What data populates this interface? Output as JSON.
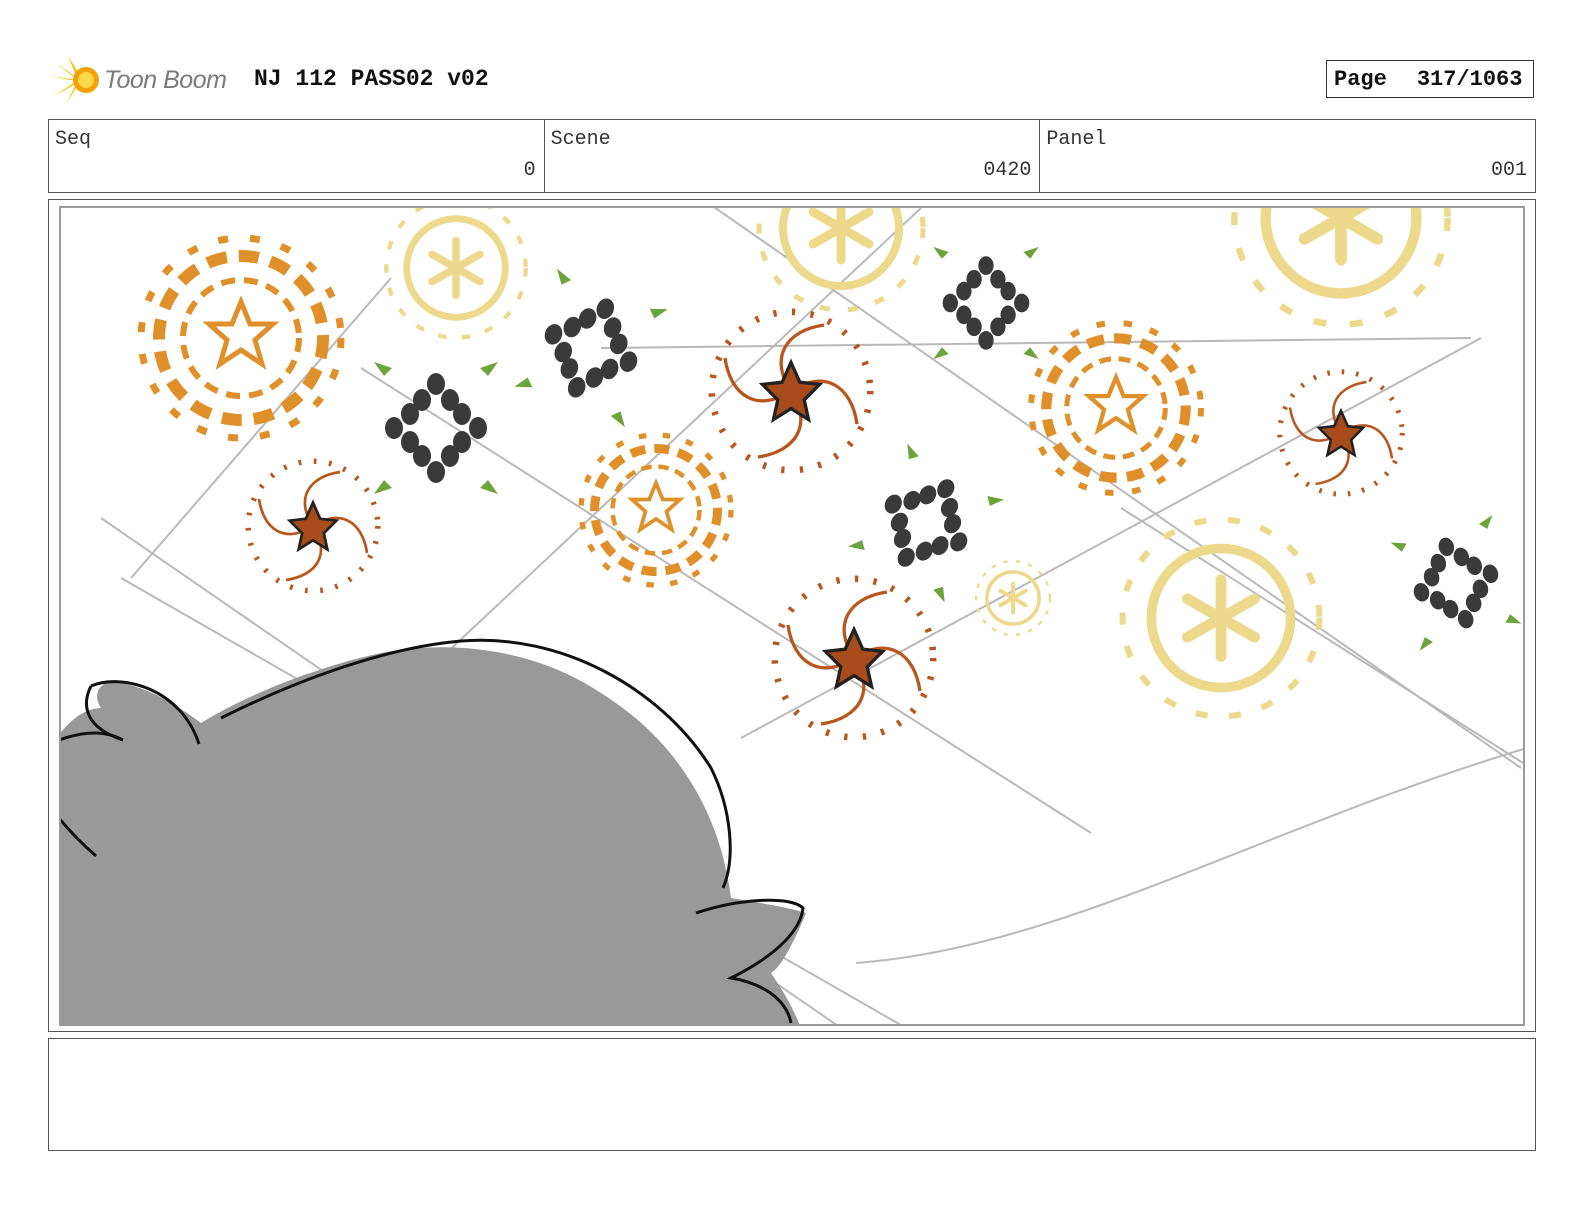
{
  "header": {
    "logo_text": "Toon Boom",
    "doc_title": "NJ 112 PASS02 v02",
    "page_label": "Page",
    "page_value": "317/1063"
  },
  "info": {
    "seq_label": "Seq",
    "seq_value": "0",
    "scene_label": "Scene",
    "scene_value": "0420",
    "panel_label": "Panel",
    "panel_value": "001"
  },
  "colors": {
    "orange": "#e0902a",
    "pale_yellow": "#ecd98c",
    "dark_dots": "#3a3a3a",
    "leaf_green": "#6ca33a",
    "rust": "#b8561e",
    "silhouette_gray": "#999999"
  },
  "notes": ""
}
